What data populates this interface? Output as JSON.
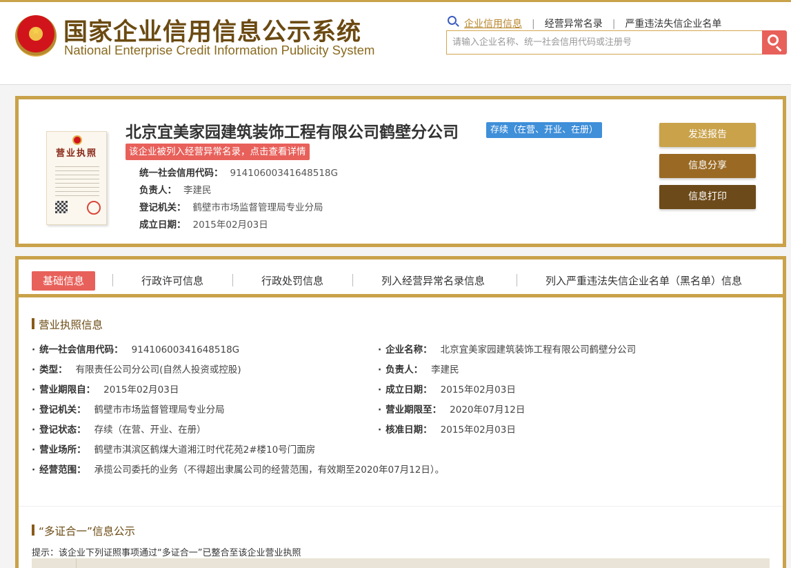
{
  "header": {
    "title_cn": "国家企业信用信息公示系统",
    "title_en": "National Enterprise Credit Information Publicity System",
    "nav": [
      "企业信用信息",
      "经营异常名录",
      "严重违法失信企业名单"
    ],
    "search_placeholder": "请输入企业名称、统一社会信用代码或注册号"
  },
  "company": {
    "name": "北京宜美家园建筑装饰工程有限公司鹤壁分公司",
    "status": "存续（在营、开业、在册）",
    "alert": "该企业被列入经营异常名录，点击查看详情",
    "license_label": "营业执照",
    "summary": [
      {
        "key": "统一社会信用代码：",
        "value": "91410600341648518G"
      },
      {
        "key": "负责人：",
        "value": "李建民"
      },
      {
        "key": "登记机关：",
        "value": "鹤壁市市场监督管理局专业分局"
      },
      {
        "key": "成立日期：",
        "value": "2015年02月03日"
      }
    ],
    "buttons": [
      "发送报告",
      "信息分享",
      "信息打印"
    ]
  },
  "tabs": [
    "基础信息",
    "行政许可信息",
    "行政处罚信息",
    "列入经营异常名录信息",
    "列入严重违法失信企业名单（黑名单）信息"
  ],
  "license_section": {
    "title": "营业执照信息",
    "dot": "·",
    "fields": [
      {
        "key": "统一社会信用代码：",
        "value": "91410600341648518G"
      },
      {
        "key": "企业名称：",
        "value": "北京宜美家园建筑装饰工程有限公司鹤壁分公司"
      },
      {
        "key": "类型：",
        "value": "有限责任公司分公司(自然人投资或控股)"
      },
      {
        "key": "负责人：",
        "value": "李建民"
      },
      {
        "key": "营业期限自：",
        "value": "2015年02月03日"
      },
      {
        "key": "成立日期：",
        "value": "2015年02月03日"
      },
      {
        "key": "登记机关：",
        "value": "鹤壁市市场监督管理局专业分局"
      },
      {
        "key": "营业期限至：",
        "value": "2020年07月12日"
      },
      {
        "key": "登记状态：",
        "value": "存续（在营、开业、在册）"
      },
      {
        "key": "核准日期：",
        "value": "2015年02月03日"
      },
      {
        "key": "营业场所：",
        "value": "鹤壁市淇滨区鹤煤大道湘江时代花苑2#楼10号门面房"
      },
      {
        "key": "经营范围：",
        "value": "承揽公司委托的业务（不得超出隶属公司的经营范围，有效期至2020年07月12日）。"
      }
    ]
  },
  "multi_cert_section": {
    "title": "“多证合一”信息公示",
    "hint": "提示：该企业下列证照事项通过“多证合一”已整合至该企业营业执照"
  }
}
